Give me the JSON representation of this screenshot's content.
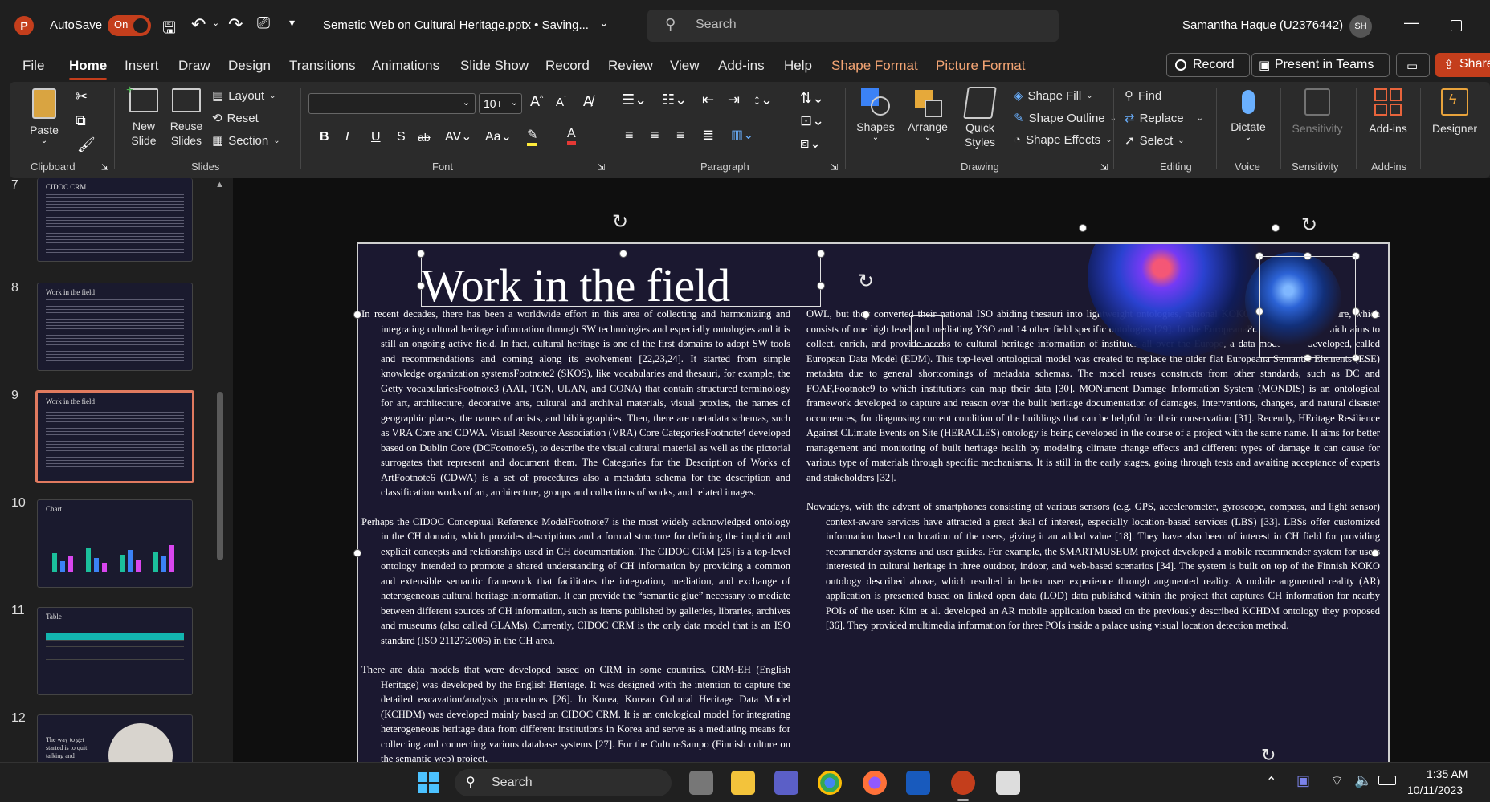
{
  "titlebar": {
    "autosave_label": "AutoSave",
    "autosave_state": "On",
    "doc_title": "Semetic Web on Cultural Heritage.pptx • Saving...",
    "search_placeholder": "Search",
    "user_name": "Samantha Haque (U2376442)",
    "user_initials": "SH"
  },
  "tabs": [
    "File",
    "Home",
    "Insert",
    "Draw",
    "Design",
    "Transitions",
    "Animations",
    "Slide Show",
    "Record",
    "Review",
    "View",
    "Add-ins",
    "Help"
  ],
  "context_tabs": [
    "Shape Format",
    "Picture Format"
  ],
  "right_buttons": {
    "record": "Record",
    "present": "Present in Teams",
    "share": "Share"
  },
  "ribbon": {
    "clipboard": {
      "paste": "Paste",
      "label": "Clipboard"
    },
    "slides": {
      "new_slide": "New Slide",
      "reuse_slides": "Reuse Slides",
      "layout": "Layout",
      "reset": "Reset",
      "section": "Section",
      "label": "Slides"
    },
    "font": {
      "size": "10+",
      "label": "Font",
      "bold": "B",
      "italic": "I",
      "underline": "U",
      "shadow": "S",
      "strike": "ab"
    },
    "paragraph": {
      "label": "Paragraph"
    },
    "drawing": {
      "shapes": "Shapes",
      "arrange": "Arrange",
      "quick_styles": "Quick Styles",
      "shape_fill": "Shape Fill",
      "shape_outline": "Shape Outline",
      "shape_effects": "Shape Effects",
      "label": "Drawing"
    },
    "editing": {
      "find": "Find",
      "replace": "Replace",
      "select": "Select",
      "label": "Editing"
    },
    "voice": {
      "dictate": "Dictate",
      "label": "Voice"
    },
    "sensitivity": {
      "sensitivity": "Sensitivity",
      "label": "Sensitivity"
    },
    "addins": {
      "addins": "Add-ins",
      "label": "Add-ins"
    },
    "designer": {
      "designer": "Designer"
    }
  },
  "thumbnails": [
    {
      "num": "7",
      "title": "CIDOC CRM"
    },
    {
      "num": "8",
      "title": "Work in the field"
    },
    {
      "num": "9",
      "title": "Work in the field"
    },
    {
      "num": "10",
      "title": "Chart"
    },
    {
      "num": "11",
      "title": "Table"
    },
    {
      "num": "12",
      "title": "The way to get started is to quit talking and"
    }
  ],
  "slide": {
    "title": "Work in the field",
    "left_col": [
      "In recent decades, there has been a worldwide effort in this area of collecting and harmonizing and integrating cultural heritage information through SW technologies and especially ontologies and it is still an ongoing active field. In fact, cultural heritage is one of the first domains to adopt SW tools and recommendations and coming along its evolvement [22,23,24]. It started from simple knowledge organization systemsFootnote2 (SKOS), like vocabularies and thesauri, for example, the Getty vocabulariesFootnote3 (AAT, TGN, ULAN, and CONA) that contain structured terminology for art, architecture, decorative arts, cultural and archival materials, visual proxies, the names of geographic places, the names of artists, and bibliographies. Then, there are metadata schemas, such as VRA Core and CDWA. Visual Resource Association (VRA) Core CategoriesFootnote4 developed based on Dublin Core (DCFootnote5), to describe the visual cultural material as well as the pictorial surrogates that represent and document them. The Categories for the Description of Works of ArtFootnote6 (CDWA) is a set of procedures also a metadata schema for the description and classification works of art, architecture, groups and collections of works, and related images.",
      "Perhaps the CIDOC Conceptual Reference ModelFootnote7 is the most widely acknowledged ontology in the CH domain, which provides descriptions and a formal structure for defining the implicit and explicit concepts and relationships used in CH documentation. The CIDOC CRM [25] is a top-level ontology intended to promote a shared understanding of CH information by providing a common and extensible semantic framework that facilitates the integration, mediation, and exchange of heterogeneous cultural heritage information. It can provide the “semantic glue” necessary to mediate between different sources of CH information, such as items published by galleries, libraries, archives and museums (also called GLAMs). Currently, CIDOC CRM is the only data model that is an ISO standard (ISO 21127:2006) in the CH area.",
      "There are data models that were developed based on CRM in some countries. CRM-EH (English Heritage) was developed by the English Heritage. It was designed with the intention to capture the detailed excavation/analysis procedures [26]. In Korea, Korean Cultural Heritage Data Model (KCHDM) was developed mainly based on CIDOC CRM. It is an ontological model for integrating heterogeneous heritage data from different institutions in Korea and serve as a mediating means for collecting and connecting various database systems [27]. For the CultureSampo (Finnish culture on the semantic web) project,"
    ],
    "right_col": [
      "OWL, but they converted their national ISO abiding thesauri into lightweight ontologies, national KOKO ontology infrastructure, which consists of one high level and mediating YSO and 14 other field specific ontologies [29]. In the EuropeanaFootnote8 project which aims to collect, enrich, and provide access to cultural heritage information of institutes all over the Europe, a data model was developed, called European Data Model (EDM). This top-level ontological model was created to replace the older flat Europeana Semantic Elements (ESE) metadata due to general shortcomings of metadata schemas. The model reuses constructs from other standards, such as DC and FOAF,Footnote9 to which institutions can map their data [30]. MONument Damage Information System (MONDIS) is an ontological framework developed to capture and reason over the built heritage documentation of damages, interventions, changes, and natural disaster occurrences, for diagnosing current condition of the buildings that can be helpful for their conservation [31]. Recently, HEritage Resilience Against CLimate Events on Site (HERACLES) ontology is being developed in the course of a project with the same name. It aims for better management and monitoring of built heritage health by modeling climate change effects and different types of damage it can cause for various type of materials through specific mechanisms. It is still in the early stages, going through tests and awaiting acceptance of experts and stakeholders [32].",
      "Nowadays, with the advent of smartphones consisting of various sensors (e.g. GPS, accelerometer, gyroscope, compass, and light sensor) context-aware services have attracted a great deal of interest, especially location-based services (LBS) [33]. LBSs offer customized information based on location of the users, giving it an added value [18]. They have also been of interest in CH field for providing recommender systems and user guides. For example, the SMARTMUSEUM project developed a mobile recommender system for users interested in cultural heritage in three outdoor, indoor, and web-based scenarios [34]. The system is built on top of the Finnish KOKO ontology described above, which resulted in better user experience through augmented reality. A mobile augmented reality (AR) application is presented based on linked open data (LOD) data published within the project that captures CH information for nearby POIs of the user. Kim et al. developed an AR mobile application based on the previously described KCHDM ontology they proposed [36]. They provided multimedia information for three POIs inside a palace using visual location detection method."
    ]
  },
  "taskbar": {
    "search": "Search",
    "time": "1:35 AM",
    "date": "10/11/2023"
  },
  "colors": {
    "accent": "#c43e1c",
    "context": "#f4a574",
    "slide_bg": "#1b1830"
  }
}
